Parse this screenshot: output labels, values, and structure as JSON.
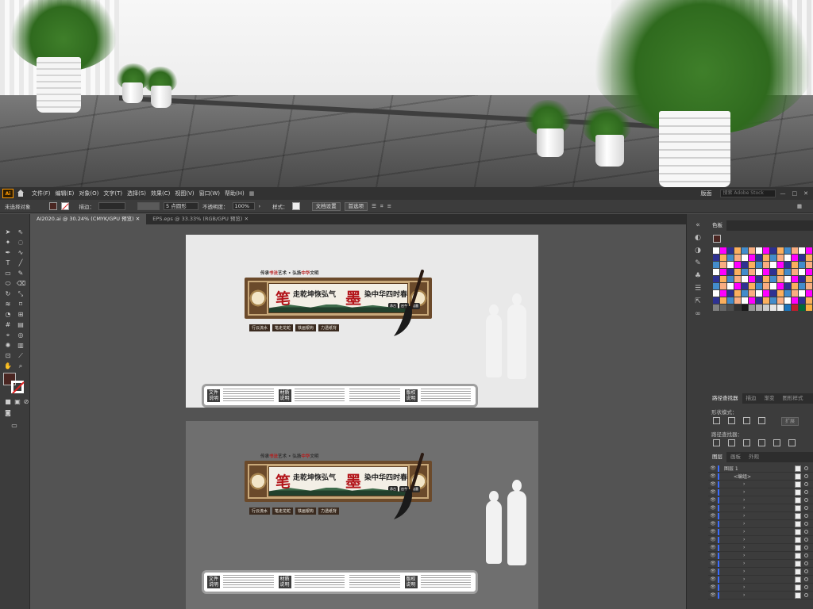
{
  "menubar": {
    "app_logo": "Ai",
    "items": [
      "文件(F)",
      "编辑(E)",
      "对象(O)",
      "文字(T)",
      "选择(S)",
      "效果(C)",
      "视图(V)",
      "窗口(W)",
      "帮助(H)"
    ],
    "workspace": "版面",
    "search_placeholder": "搜索 Adobe Stock",
    "window_buttons": [
      "—",
      "□",
      "✕"
    ]
  },
  "controlbar": {
    "selection": "未选择对象",
    "stroke_label": "描边：",
    "brush_value": "5 点圆形",
    "opacity_label": "不透明度：",
    "opacity_value": "100%",
    "style_label": "样式：",
    "doc_setup_button": "文档设置",
    "preferences_button": "首选项",
    "fill_color": "#4a2622"
  },
  "tabs": [
    {
      "label": "AI2020.ai @ 30.24% (CMYK/GPU 预览)",
      "active": true
    },
    {
      "label": "EPS.eps @ 33.33% (RGB/GPU 预览)",
      "active": false
    }
  ],
  "design": {
    "topline_a": "传承",
    "topline_red1": "书法",
    "topline_b": "艺术 • 弘扬",
    "topline_red2": "中华",
    "topline_c": "文明",
    "calli_left": "笔",
    "text_left": "走乾坤恢弘气",
    "calli_right": "墨",
    "text_right": "染中华四时春",
    "mini_tags": [
      "承古",
      "启今",
      "笔墨"
    ],
    "tags": [
      "行云流水",
      "笔走龙蛇",
      "铁画银钩",
      "力透纸背"
    ],
    "info_labels": [
      "文件说明",
      "材质说明",
      "版权说明"
    ],
    "info_heads": [
      "二、小组材质",
      "三、面组材质"
    ]
  },
  "panels": {
    "swatch_tab": "色板",
    "pathfinder_tabs": [
      "路径查找器",
      "描边",
      "渐变",
      "图形样式"
    ],
    "shape_mode_label": "形状模式：",
    "expand_button": "扩展",
    "pathfinder_label": "路径查找器：",
    "layer_tabs": [
      "图层",
      "画板",
      "外观"
    ],
    "layer_name": "图层 1",
    "group_name": "<编组>"
  }
}
